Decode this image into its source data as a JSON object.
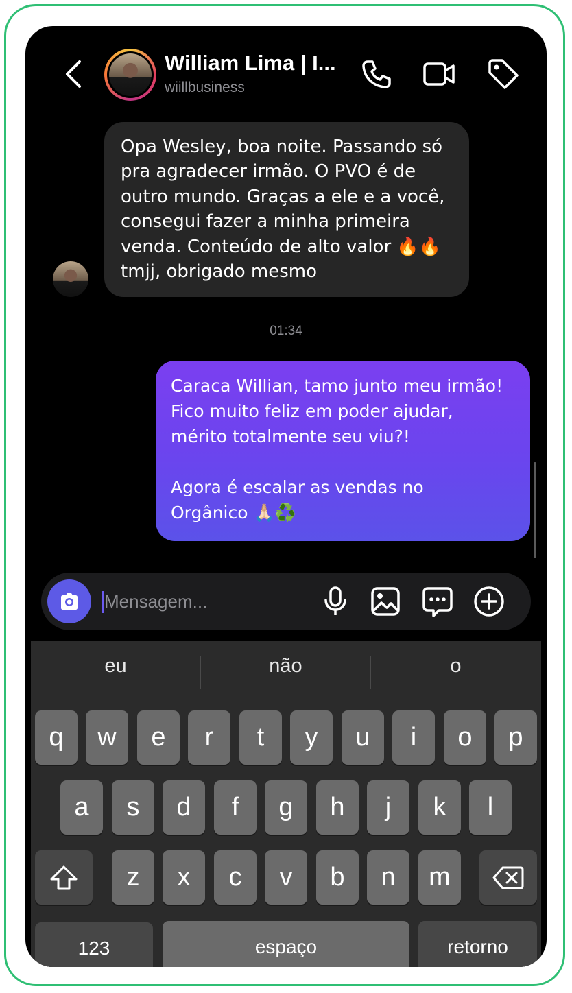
{
  "header": {
    "name": "William Lima | I...",
    "handle": "wiillbusiness",
    "icons": [
      "chevron-left-icon",
      "phone-icon",
      "video-icon",
      "tag-icon"
    ]
  },
  "messages": {
    "incoming_text": "Opa Wesley, boa noite. Passando só\npra agradecer irmão. O PVO é de\noutro mundo. Graças a ele e a você,\nconsegui fazer a minha primeira\nvenda. Conteúdo de alto valor 🔥🔥\ntmjj, obrigado mesmo",
    "time": "01:34",
    "outgoing_text": "Caraca Willian, tamo junto meu irmão!\nFico muito feliz em poder ajudar,\nmérito totalmente seu viu?!\n\nAgora é escalar as vendas no\nOrgânico 🙏🏻♻️"
  },
  "composer": {
    "placeholder": "Mensagem...",
    "icons": [
      "camera-icon",
      "microphone-icon",
      "image-icon",
      "chat-bubble-icon",
      "plus-circle-icon"
    ]
  },
  "keyboard": {
    "suggestions": [
      "eu",
      "não",
      "o"
    ],
    "row1": [
      "q",
      "w",
      "e",
      "r",
      "t",
      "y",
      "u",
      "i",
      "o",
      "p"
    ],
    "row2": [
      "a",
      "s",
      "d",
      "f",
      "g",
      "h",
      "j",
      "k",
      "l"
    ],
    "row3": [
      "z",
      "x",
      "c",
      "v",
      "b",
      "n",
      "m"
    ],
    "numbers_label": "123",
    "space_label": "espaço",
    "return_label": "retorno"
  },
  "colors": {
    "frame_border": "#2fbf74",
    "outgoing_bubble": "#7b3ff0",
    "incoming_bubble": "#262626",
    "camera_button": "#5d5ae6"
  }
}
